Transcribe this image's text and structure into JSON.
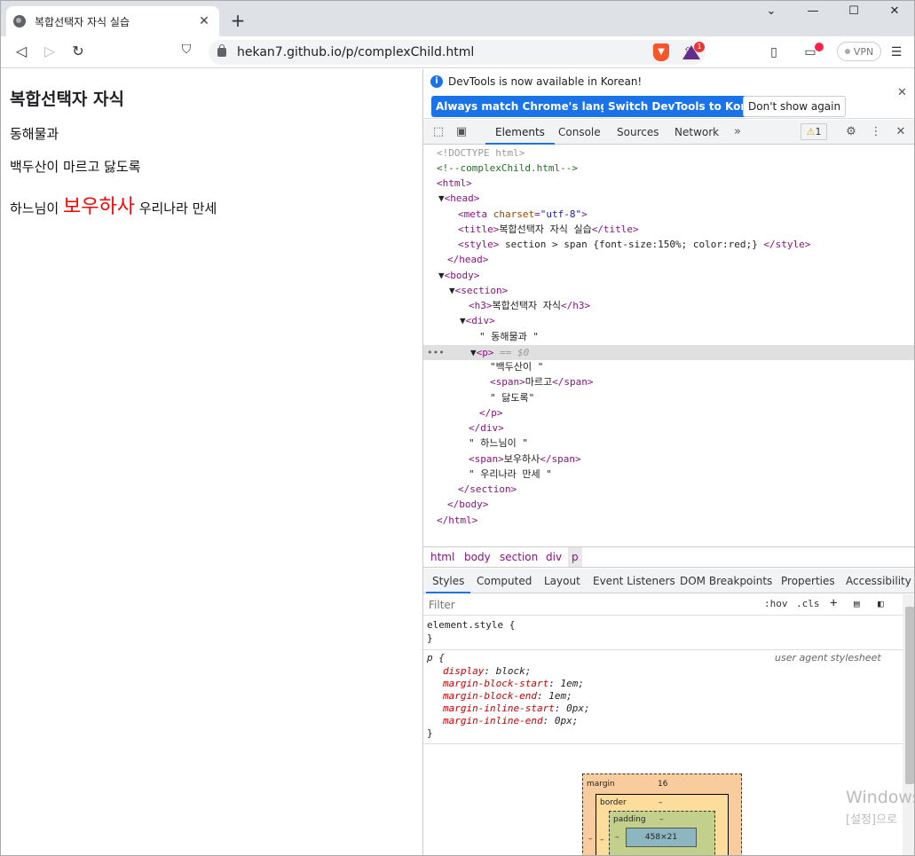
{
  "browser": {
    "tab_title": "복합선택자 자식 실습",
    "url": "hekan7.github.io/p/complexChild.html",
    "vpn_label": "VPN",
    "bat_badge": "1"
  },
  "page": {
    "heading": "복합선택자 자식",
    "line1": "동해물과",
    "line2": "백두산이 마르고 닳도록",
    "line3_before": "하느님이 ",
    "line3_big": "보우하사",
    "line3_after": " 우리나라 만세"
  },
  "devtools": {
    "info_text": "DevTools is now available in Korean!",
    "btn_match": "Always match Chrome's language",
    "btn_switch": "Switch DevTools to Korean",
    "btn_dont": "Don't show again",
    "tabs": [
      "Elements",
      "Console",
      "Sources",
      "Network"
    ],
    "warn_count": "1",
    "dom": {
      "doctype": "<!DOCTYPE html>",
      "comment": "<!--complexChild.html-->",
      "html_open": "<html>",
      "head_open": "<head>",
      "meta": "<meta charset=\"utf-8\">",
      "title_open": "<title>",
      "title_text": "복합선택자 자식 실습",
      "title_close": "</title>",
      "style_open": "<style>",
      "style_text": " section > span {font-size:150%; color:red;} ",
      "style_close": "</style>",
      "head_close": "</head>",
      "body_open": "<body>",
      "section_open": "<section>",
      "h3_open": "<h3>",
      "h3_text": "복합선택자 자식",
      "h3_close": "</h3>",
      "div_open": "<div>",
      "text1": "\" 동해물과 \"",
      "p_open": "<p>",
      "p_sel": " == $0",
      "text2": "\"백두산이 \"",
      "span_open": "<span>",
      "span1_text": "마르고",
      "span_close": "</span>",
      "text3": "\" 닳도록\"",
      "p_close": "</p>",
      "div_close": "</div>",
      "text4": "\" 하느님이 \"",
      "span2_text": "보우하사",
      "text5": "\" 우리나라 만세 \"",
      "section_close": "</section>",
      "body_close": "</body>",
      "html_close": "</html>"
    },
    "breadcrumbs": [
      "html",
      "body",
      "section",
      "div",
      "p"
    ],
    "style_tabs": [
      "Styles",
      "Computed",
      "Layout",
      "Event Listeners",
      "DOM Breakpoints",
      "Properties",
      "Accessibility"
    ],
    "filter_placeholder": "Filter",
    "hov": ":hov",
    "cls": ".cls",
    "element_style": "element.style {",
    "close_brace": "}",
    "p_rule": "p {",
    "ua_label": "user agent stylesheet",
    "props": [
      {
        "name": "display",
        "value": "block;"
      },
      {
        "name": "margin-block-start",
        "value": "1em;"
      },
      {
        "name": "margin-block-end",
        "value": "1em;"
      },
      {
        "name": "margin-inline-start",
        "value": "0px;"
      },
      {
        "name": "margin-inline-end",
        "value": "0px;"
      }
    ],
    "boxmodel": {
      "margin_label": "margin",
      "margin_val": "16",
      "border_label": "border",
      "border_val": "–",
      "padding_label": "padding",
      "padding_val": "–",
      "content": "458×21",
      "side": "–"
    }
  },
  "watermark": {
    "line1": "Windows",
    "line2": "[설정]으로"
  }
}
